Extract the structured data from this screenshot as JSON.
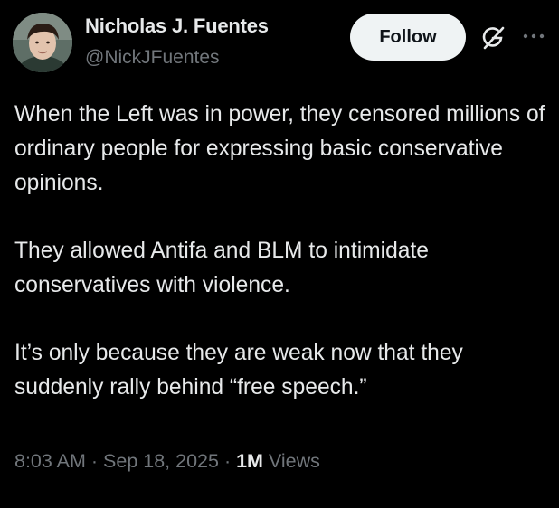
{
  "author": {
    "display_name": "Nicholas J. Fuentes",
    "handle": "@NickJFuentes"
  },
  "actions": {
    "follow_label": "Follow",
    "grok_icon": "grok-icon",
    "more_icon": "more-options-icon"
  },
  "tweet": {
    "paragraphs": [
      "When the Left was in power, they censored millions of ordinary people for expressing basic conservative opinions.",
      "They allowed Antifa and BLM to intimidate conservatives with violence.",
      "It’s only because they are weak now that they suddenly rally behind “free speech.”"
    ]
  },
  "meta": {
    "time": "8:03 AM",
    "separator": "·",
    "date": "Sep 18, 2025",
    "views_count": "1M",
    "views_label": "Views"
  },
  "colors": {
    "background": "#000000",
    "primary_text": "#e7e9ea",
    "secondary_text": "#71767b",
    "follow_button_bg": "#eff3f4",
    "follow_button_text": "#0f1419",
    "divider": "#2f3336"
  }
}
